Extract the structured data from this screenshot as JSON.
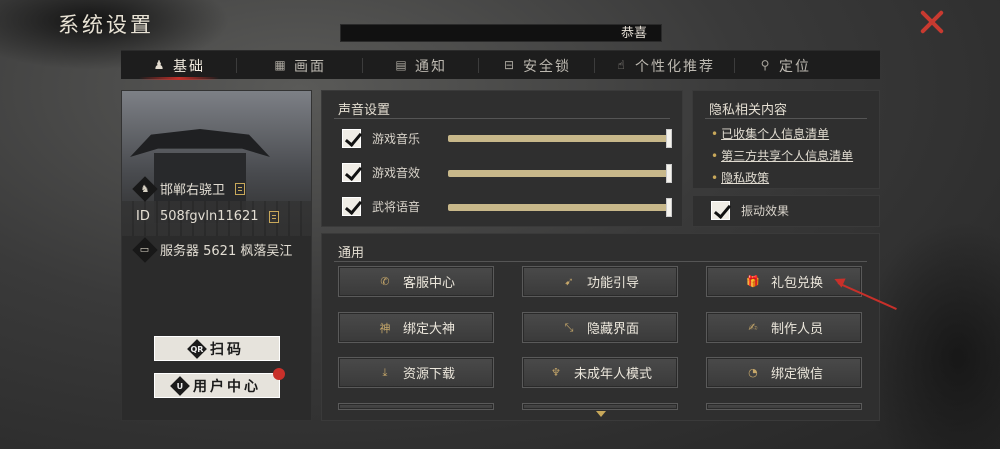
{
  "window": {
    "title": "系统设置",
    "close_icon": "close-x-icon"
  },
  "notice": {
    "text": "恭喜"
  },
  "tabs": [
    {
      "label": "基础",
      "icon": "character-icon",
      "glyph": "♟",
      "active": true
    },
    {
      "label": "画面",
      "icon": "picture-icon",
      "glyph": "▦",
      "active": false
    },
    {
      "label": "通知",
      "icon": "chat-icon",
      "glyph": "▤",
      "active": false
    },
    {
      "label": "安全锁",
      "icon": "lock-icon",
      "glyph": "⊟",
      "active": false
    },
    {
      "label": "个性化推荐",
      "icon": "thumb-up-icon",
      "glyph": "☝",
      "active": false
    },
    {
      "label": "定位",
      "icon": "location-pin-icon",
      "glyph": "⚲",
      "active": false
    }
  ],
  "profile": {
    "name": "邯郸右骁卫",
    "id_label": "ID",
    "id": "508fgvln11621",
    "server": "服务器 5621 枫落吴江",
    "scan_button": "扫码",
    "scan_icon_text": "QR",
    "user_center_button": "用户中心",
    "user_center_icon_text": "U"
  },
  "sound": {
    "title": "声音设置",
    "rows": [
      {
        "label": "游戏音乐",
        "checked": true,
        "level": 1.0
      },
      {
        "label": "游戏音效",
        "checked": true,
        "level": 1.0
      },
      {
        "label": "武将语音",
        "checked": true,
        "level": 1.0
      }
    ]
  },
  "privacy": {
    "title": "隐私相关内容",
    "links": [
      "已收集个人信息清单",
      "第三方共享个人信息清单",
      "隐私政策"
    ]
  },
  "vibration": {
    "label": "振动效果",
    "checked": true
  },
  "general": {
    "title": "通用",
    "buttons": [
      {
        "label": "客服中心",
        "icon": "phone-icon",
        "glyph": "✆"
      },
      {
        "label": "功能引导",
        "icon": "guide-icon",
        "glyph": "➹"
      },
      {
        "label": "礼包兑换",
        "icon": "gift-icon",
        "glyph": "🎁"
      },
      {
        "label": "绑定大神",
        "icon": "god-icon",
        "glyph": "神"
      },
      {
        "label": "隐藏界面",
        "icon": "resize-icon",
        "glyph": "⤡"
      },
      {
        "label": "制作人员",
        "icon": "staff-icon",
        "glyph": "✍"
      },
      {
        "label": "资源下载",
        "icon": "download-icon",
        "glyph": "⤓"
      },
      {
        "label": "未成年人模式",
        "icon": "shield-wing-icon",
        "glyph": "♆"
      },
      {
        "label": "绑定微信",
        "icon": "wechat-icon",
        "glyph": "◔"
      }
    ]
  },
  "colors": {
    "accent_red": "#c8302a",
    "gold": "#c8a85a"
  }
}
